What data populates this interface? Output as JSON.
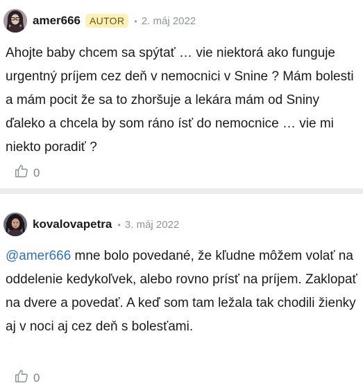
{
  "posts": [
    {
      "username": "amer666",
      "badge": "AUTOR",
      "separator": "•",
      "date": "2. máj 2022",
      "body": "Ahojte baby chcem sa spýtať … vie niektorá ako funguje urgentný príjem cez deň v nemocnici v Snine ? Mám bolesti a mám pocit že sa to zhoršuje a lekára mám od Sniny ďaleko a chcela by som ráno ísť do nemocnice … vie mi niekto poradiť ?",
      "likes": "0",
      "like_icon": "thumbs-up-icon"
    },
    {
      "username": "kovalovapetra",
      "separator": "•",
      "date": "3. máj 2022",
      "mention": "@amer666",
      "body": " mne bolo povedané, že kľudne môžem volať na oddelenie kedykoľvek, alebo rovno prísť na príjem. Zaklopať na dvere a povedať. A keď som tam ležala tak chodili žienky aj v noci aj cez deň s bolesťami.",
      "likes": "0",
      "like_icon": "thumbs-up-icon"
    }
  ],
  "colors": {
    "badge_bg": "#fcf1b8",
    "mention": "#2f6fc4",
    "divider": "#ececec"
  }
}
